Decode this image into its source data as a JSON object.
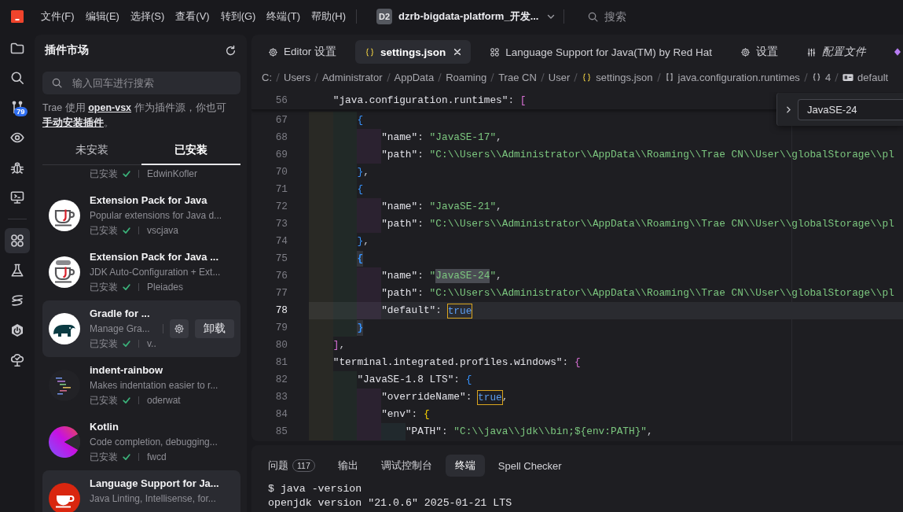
{
  "title_bar": {
    "menu": [
      "文件(F)",
      "编辑(E)",
      "选择(S)",
      "查看(V)",
      "转到(G)",
      "终端(T)",
      "帮助(H)"
    ],
    "project": {
      "initials": "D2",
      "name": "dzrb-bigdata-platform_开发..."
    },
    "search": {
      "placeholder": "搜索"
    }
  },
  "activity_bar": [
    {
      "kind": "explorer",
      "selected": false
    },
    {
      "kind": "search",
      "selected": false
    },
    {
      "kind": "git",
      "selected": false,
      "badge": "79"
    },
    {
      "kind": "watch",
      "selected": false
    },
    {
      "kind": "debug",
      "selected": false
    },
    {
      "kind": "remote",
      "selected": false
    },
    {
      "kind": "separator"
    },
    {
      "kind": "extensions",
      "selected": true
    },
    {
      "kind": "testing",
      "selected": false
    },
    {
      "kind": "coil",
      "selected": false
    },
    {
      "kind": "power",
      "selected": false
    },
    {
      "kind": "tree",
      "selected": false
    }
  ],
  "sidebar": {
    "title": "插件市场",
    "search": {
      "placeholder": "输入回车进行搜索"
    },
    "notice": [
      {
        "kind": "text",
        "text": "Trae 使用 "
      },
      {
        "kind": "link",
        "text": "open-vsx"
      },
      {
        "kind": "text",
        "text": " 作为插件源，你也可"
      },
      {
        "kind": "link",
        "text": "手动安装插件"
      },
      {
        "kind": "text",
        "text": "。"
      }
    ],
    "tabs": [
      {
        "label": "未安装",
        "selected": false
      },
      {
        "label": "已安装",
        "selected": true
      }
    ],
    "extensions": [
      {
        "kind": "clipped",
        "status": "已安装",
        "publisher": "EdwinKofler",
        "highlighted": false
      },
      {
        "kind": "javapack",
        "name": "Extension Pack for Java",
        "description": "Popular extensions for Java d...",
        "status": "已安装",
        "publisher": "vscjava",
        "highlighted": false
      },
      {
        "kind": "autoconfig",
        "name": "Extension Pack for Java ...",
        "description": "JDK Auto-Configuration + Ext...",
        "status": "已安装",
        "publisher": "Pleiades",
        "highlighted": false
      },
      {
        "kind": "gradle",
        "name": "Gradle for ...",
        "description": "Manage Gra...",
        "status": "已安装",
        "publisher": "v..",
        "highlighted": true,
        "uninstall": "卸载"
      },
      {
        "kind": "rainbow",
        "name": "indent-rainbow",
        "description": "Makes indentation easier to r...",
        "status": "已安装",
        "publisher": "oderwat",
        "highlighted": false
      },
      {
        "kind": "kotlin",
        "name": "Kotlin",
        "description": "Code completion, debugging...",
        "status": "已安装",
        "publisher": "fwcd",
        "highlighted": false
      },
      {
        "kind": "redhat",
        "name": "Language Support for Ja...",
        "description": "Java Linting, Intellisense, for...",
        "highlighted": true
      }
    ]
  },
  "editor": {
    "tabs": [
      {
        "kind": "settings",
        "label": "Editor 设置",
        "selected": false,
        "preview": false,
        "closable": false
      },
      {
        "kind": "json",
        "label": "settings.json",
        "selected": true,
        "preview": false,
        "closable": true
      },
      {
        "kind": "extension",
        "label": "Language Support for Java(TM) by Red Hat",
        "selected": false,
        "preview": false,
        "closable": false
      },
      {
        "kind": "settings",
        "label": "设置",
        "selected": false,
        "preview": false,
        "closable": false
      },
      {
        "kind": "profile",
        "label": "配置文件",
        "selected": false,
        "preview": true,
        "closable": false
      },
      {
        "kind": "agent",
        "selected": false
      }
    ],
    "breadcrumbs": [
      {
        "kind": "folder",
        "text": "C:"
      },
      {
        "kind": "folder",
        "text": "Users"
      },
      {
        "kind": "folder",
        "text": "Administrator"
      },
      {
        "kind": "folder",
        "text": "AppData"
      },
      {
        "kind": "folder",
        "text": "Roaming"
      },
      {
        "kind": "folder",
        "text": "Trae CN"
      },
      {
        "kind": "folder",
        "text": "User"
      },
      {
        "kind": "file",
        "text": "settings.json"
      },
      {
        "kind": "array",
        "text": "java.configuration.runtimes"
      },
      {
        "kind": "object",
        "text": "4"
      },
      {
        "kind": "property",
        "text": "default"
      }
    ],
    "find": {
      "value": "JavaSE-24"
    },
    "sticky_line": {
      "number": "56",
      "tokens": [
        {
          "kind": "key",
          "text": "    \"java.configuration.runtimes\""
        },
        {
          "kind": "plain",
          "text": ": "
        },
        {
          "kind": "bracket",
          "text": "[",
          "color": "#da70d6"
        }
      ]
    },
    "lines": [
      {
        "number": "67",
        "current": false,
        "tokens": [
          {
            "kind": "bracket",
            "text": "        {",
            "color": "#3794ff"
          }
        ]
      },
      {
        "number": "68",
        "current": false,
        "tokens": [
          {
            "kind": "key",
            "text": "            \"name\""
          },
          {
            "kind": "plain",
            "text": ": "
          },
          {
            "kind": "string",
            "text": "\"JavaSE-17\""
          },
          {
            "kind": "plain",
            "text": ","
          }
        ]
      },
      {
        "number": "69",
        "current": false,
        "tokens": [
          {
            "kind": "key",
            "text": "            \"path\""
          },
          {
            "kind": "plain",
            "text": ": "
          },
          {
            "kind": "string",
            "text": "\"C:\\\\Users\\\\Administrator\\\\AppData\\\\Roaming\\\\Trae CN\\\\User\\\\globalStorage\\\\pl"
          }
        ]
      },
      {
        "number": "70",
        "current": false,
        "tokens": [
          {
            "kind": "bracket",
            "text": "        }",
            "color": "#3794ff"
          },
          {
            "kind": "plain",
            "text": ","
          }
        ]
      },
      {
        "number": "71",
        "current": false,
        "tokens": [
          {
            "kind": "bracket",
            "text": "        {",
            "color": "#3794ff"
          }
        ]
      },
      {
        "number": "72",
        "current": false,
        "tokens": [
          {
            "kind": "key",
            "text": "            \"name\""
          },
          {
            "kind": "plain",
            "text": ": "
          },
          {
            "kind": "string",
            "text": "\"JavaSE-21\""
          },
          {
            "kind": "plain",
            "text": ","
          }
        ]
      },
      {
        "number": "73",
        "current": false,
        "tokens": [
          {
            "kind": "key",
            "text": "            \"path\""
          },
          {
            "kind": "plain",
            "text": ": "
          },
          {
            "kind": "string",
            "text": "\"C:\\\\Users\\\\Administrator\\\\AppData\\\\Roaming\\\\Trae CN\\\\User\\\\globalStorage\\\\pl"
          }
        ]
      },
      {
        "number": "74",
        "current": false,
        "tokens": [
          {
            "kind": "bracket",
            "text": "        }",
            "color": "#3794ff"
          },
          {
            "kind": "plain",
            "text": ","
          }
        ]
      },
      {
        "number": "75",
        "current": false,
        "tokens": [
          {
            "kind": "bracket",
            "text": "        {",
            "color": "#3794ff",
            "bracket_match": true
          }
        ]
      },
      {
        "number": "76",
        "current": false,
        "tokens": [
          {
            "kind": "key",
            "text": "            \"name\""
          },
          {
            "kind": "plain",
            "text": ": "
          },
          {
            "kind": "string",
            "text": "\""
          },
          {
            "kind": "string",
            "text": "JavaSE-24",
            "find_match": true
          },
          {
            "kind": "string",
            "text": "\""
          },
          {
            "kind": "plain",
            "text": ","
          }
        ]
      },
      {
        "number": "77",
        "current": false,
        "tokens": [
          {
            "kind": "key",
            "text": "            \"path\""
          },
          {
            "kind": "plain",
            "text": ": "
          },
          {
            "kind": "string",
            "text": "\"C:\\\\Users\\\\Administrator\\\\AppData\\\\Roaming\\\\Trae CN\\\\User\\\\globalStorage\\\\pl"
          }
        ]
      },
      {
        "number": "78",
        "current": true,
        "tokens": [
          {
            "kind": "key",
            "text": "            \"default\""
          },
          {
            "kind": "plain",
            "text": ": "
          },
          {
            "kind": "bool",
            "text": "true",
            "occurrence": true
          }
        ]
      },
      {
        "number": "79",
        "current": false,
        "tokens": [
          {
            "kind": "bracket",
            "text": "        }",
            "color": "#3794ff",
            "bracket_match": true
          }
        ]
      },
      {
        "number": "80",
        "current": false,
        "tokens": [
          {
            "kind": "bracket",
            "text": "    ]",
            "color": "#da70d6"
          },
          {
            "kind": "plain",
            "text": ","
          }
        ]
      },
      {
        "number": "81",
        "current": false,
        "tokens": [
          {
            "kind": "key",
            "text": "    \"terminal.integrated.profiles.windows\""
          },
          {
            "kind": "plain",
            "text": ": "
          },
          {
            "kind": "bracket",
            "text": "{",
            "color": "#da70d6"
          }
        ]
      },
      {
        "number": "82",
        "current": false,
        "tokens": [
          {
            "kind": "key",
            "text": "        \"JavaSE-1.8 LTS\""
          },
          {
            "kind": "plain",
            "text": ": "
          },
          {
            "kind": "bracket",
            "text": "{",
            "color": "#3794ff"
          }
        ]
      },
      {
        "number": "83",
        "current": false,
        "tokens": [
          {
            "kind": "key",
            "text": "            \"overrideName\""
          },
          {
            "kind": "plain",
            "text": ": "
          },
          {
            "kind": "bool",
            "text": "true",
            "occurrence": true
          },
          {
            "kind": "plain",
            "text": ","
          }
        ]
      },
      {
        "number": "84",
        "current": false,
        "tokens": [
          {
            "kind": "key",
            "text": "            \"env\""
          },
          {
            "kind": "plain",
            "text": ": "
          },
          {
            "kind": "bracket",
            "text": "{",
            "color": "#ffd700"
          }
        ]
      },
      {
        "number": "85",
        "current": false,
        "tokens": [
          {
            "kind": "key",
            "text": "                \"PATH\""
          },
          {
            "kind": "plain",
            "text": ": "
          },
          {
            "kind": "string",
            "text": "\"C:\\\\java\\\\jdk\\\\bin;${env:PATH}\""
          },
          {
            "kind": "plain",
            "text": ","
          }
        ]
      }
    ]
  },
  "panel": {
    "tabs": [
      {
        "label": "问题",
        "badge": "117",
        "selected": false
      },
      {
        "label": "输出",
        "selected": false
      },
      {
        "label": "调试控制台",
        "selected": false
      },
      {
        "label": "终端",
        "selected": true
      },
      {
        "label": "Spell Checker",
        "selected": false
      }
    ],
    "terminal": [
      "$ java -version",
      "openjdk version \"21.0.6\" 2025-01-21 LTS"
    ]
  }
}
